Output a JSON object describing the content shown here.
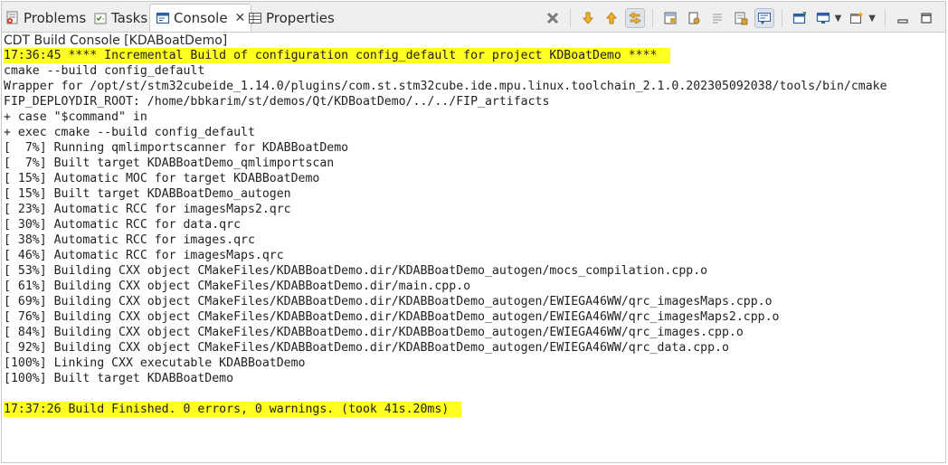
{
  "tabs": [
    {
      "label": "Problems",
      "icon": "problems-icon"
    },
    {
      "label": "Tasks",
      "icon": "tasks-icon"
    },
    {
      "label": "Console",
      "icon": "console-icon",
      "active": true
    },
    {
      "label": "Properties",
      "icon": "properties-icon"
    }
  ],
  "toolbar": {
    "icons": [
      "terminate-icon",
      "next-error-icon",
      "previous-error-icon",
      "link-to-editor-icon",
      "scroll-lock-icon",
      "pin-console-icon",
      "clear-console-icon",
      "copy-build-log-icon",
      "word-wrap-icon",
      "open-console-icon",
      "display-selected-console-icon",
      "new-console-icon",
      "minimize-icon",
      "maximize-icon"
    ],
    "accent": "#e8a317"
  },
  "console": {
    "title": "CDT Build Console [KDABoatDemo]",
    "highlight_color": "#ffff22",
    "lines": [
      {
        "text": "17:36:45 **** Incremental Build of configuration config_default for project KDBoatDemo ****",
        "highlight": true
      },
      {
        "text": "cmake --build config_default",
        "highlight": false
      },
      {
        "text": "Wrapper for /opt/st/stm32cubeide_1.14.0/plugins/com.st.stm32cube.ide.mpu.linux.toolchain_2.1.0.202305092038/tools/bin/cmake",
        "highlight": false
      },
      {
        "text": "FIP_DEPLOYDIR_ROOT: /home/bbkarim/st/demos/Qt/KDBoatDemo/../../FIP_artifacts",
        "highlight": false
      },
      {
        "text": "+ case \"$command\" in",
        "highlight": false
      },
      {
        "text": "+ exec cmake --build config_default",
        "highlight": false
      },
      {
        "text": "[  7%] Running qmlimportscanner for KDABBoatDemo",
        "highlight": false
      },
      {
        "text": "[  7%] Built target KDABBoatDemo_qmlimportscan",
        "highlight": false
      },
      {
        "text": "[ 15%] Automatic MOC for target KDABBoatDemo",
        "highlight": false
      },
      {
        "text": "[ 15%] Built target KDABBoatDemo_autogen",
        "highlight": false
      },
      {
        "text": "[ 23%] Automatic RCC for imagesMaps2.qrc",
        "highlight": false
      },
      {
        "text": "[ 30%] Automatic RCC for data.qrc",
        "highlight": false
      },
      {
        "text": "[ 38%] Automatic RCC for images.qrc",
        "highlight": false
      },
      {
        "text": "[ 46%] Automatic RCC for imagesMaps.qrc",
        "highlight": false
      },
      {
        "text": "[ 53%] Building CXX object CMakeFiles/KDABBoatDemo.dir/KDABBoatDemo_autogen/mocs_compilation.cpp.o",
        "highlight": false
      },
      {
        "text": "[ 61%] Building CXX object CMakeFiles/KDABBoatDemo.dir/main.cpp.o",
        "highlight": false
      },
      {
        "text": "[ 69%] Building CXX object CMakeFiles/KDABBoatDemo.dir/KDABBoatDemo_autogen/EWIEGA46WW/qrc_imagesMaps.cpp.o",
        "highlight": false
      },
      {
        "text": "[ 76%] Building CXX object CMakeFiles/KDABBoatDemo.dir/KDABBoatDemo_autogen/EWIEGA46WW/qrc_imagesMaps2.cpp.o",
        "highlight": false
      },
      {
        "text": "[ 84%] Building CXX object CMakeFiles/KDABBoatDemo.dir/KDABBoatDemo_autogen/EWIEGA46WW/qrc_images.cpp.o",
        "highlight": false
      },
      {
        "text": "[ 92%] Building CXX object CMakeFiles/KDABBoatDemo.dir/KDABBoatDemo_autogen/EWIEGA46WW/qrc_data.cpp.o",
        "highlight": false
      },
      {
        "text": "[100%] Linking CXX executable KDABBoatDemo",
        "highlight": false
      },
      {
        "text": "[100%] Built target KDABBoatDemo",
        "highlight": false
      },
      {
        "text": "",
        "highlight": false
      },
      {
        "text": "17:37:26 Build Finished. 0 errors, 0 warnings. (took 41s.20ms)",
        "highlight": true
      }
    ]
  }
}
